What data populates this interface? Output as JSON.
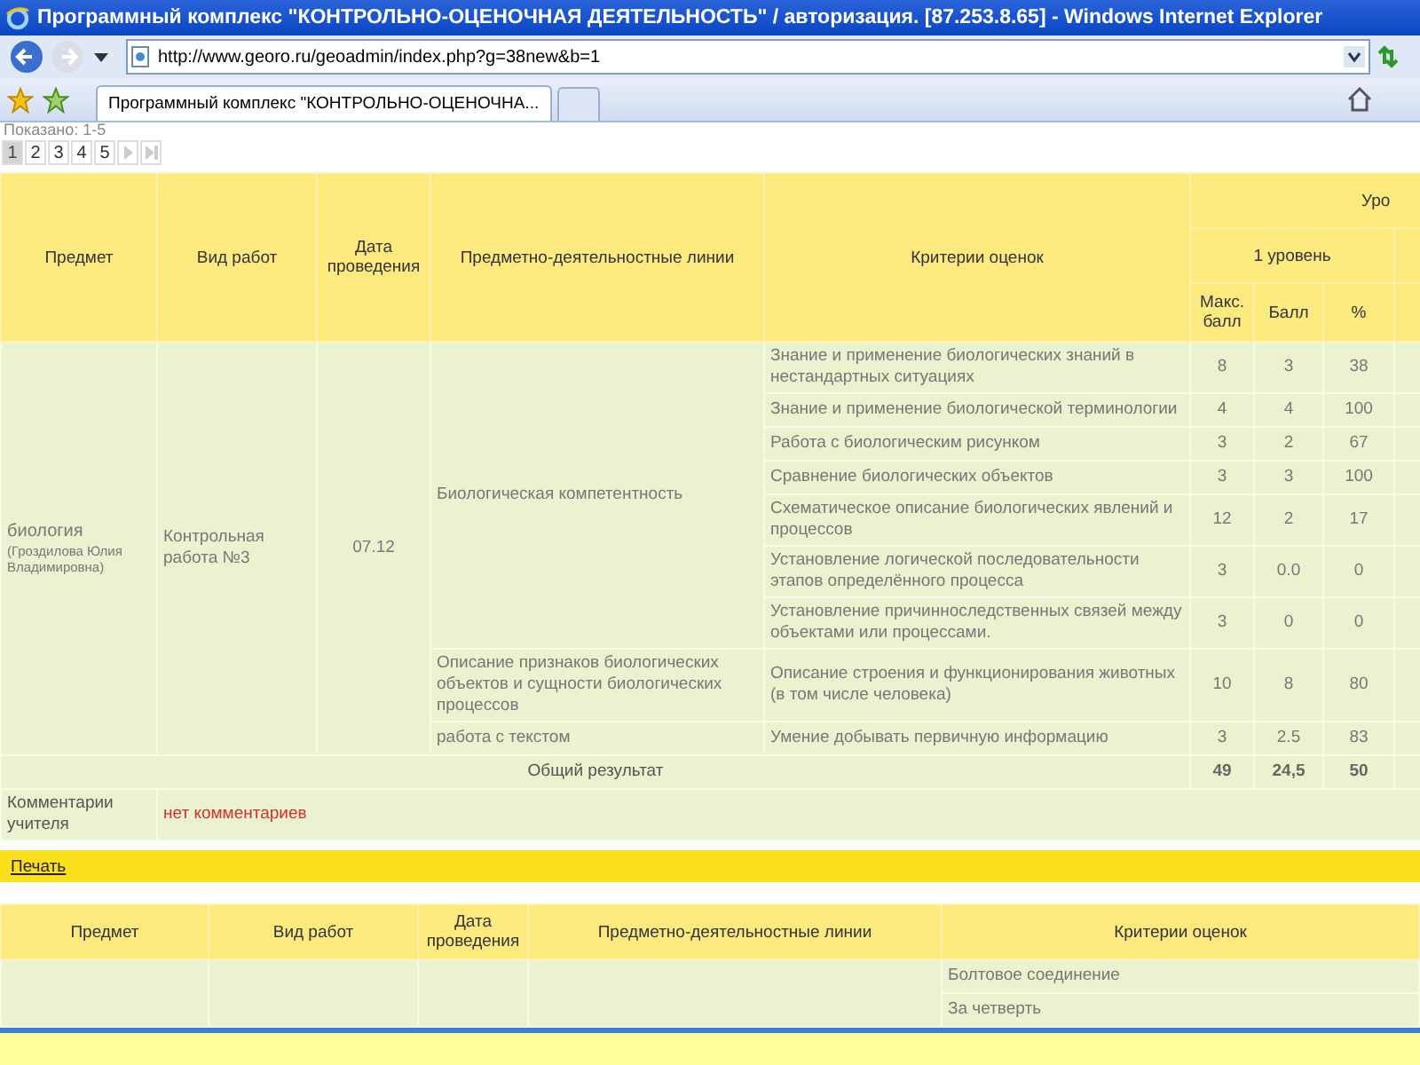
{
  "browser": {
    "title": "Программный комплекс \"КОНТРОЛЬНО-ОЦЕНОЧНАЯ ДЕЯТЕЛЬНОСТЬ\" / авторизация. [87.253.8.65] - Windows Internet Explorer",
    "url": "http://www.georo.ru/geoadmin/index.php?g=38new&b=1",
    "tab_title": "Программный комплекс \"КОНТРОЛЬНО-ОЦЕНОЧНА..."
  },
  "pager": {
    "label": "Показано: 1-5",
    "pages": [
      {
        "label": "1",
        "selected": true
      },
      {
        "label": "2",
        "selected": false
      },
      {
        "label": "3",
        "selected": false
      },
      {
        "label": "4",
        "selected": false
      },
      {
        "label": "5",
        "selected": false
      }
    ]
  },
  "results": {
    "headers": {
      "subject": "Предмет",
      "work_type": "Вид работ",
      "date": "Дата проведения",
      "lines": "Предметно-деятельностные линии",
      "criteria": "Критерии оценок",
      "level_group": "Уро",
      "level": "1 уровень",
      "max": "Макс. балл",
      "score": "Балл",
      "percent": "%"
    },
    "subject": "биология",
    "teacher": "(Гроздилова Юлия Владимировна)",
    "work_type": "Контрольная работа №3",
    "date": "07.12",
    "lines": [
      {
        "name": "Биологическая компетентность",
        "criteria": [
          {
            "text": "Знание и применение биологических знаний в нестандартных ситуациях",
            "max": "8",
            "score": "3",
            "percent": "38"
          },
          {
            "text": "Знание и применение биологической терминологии",
            "max": "4",
            "score": "4",
            "percent": "100"
          },
          {
            "text": "Работа с биологическим рисунком",
            "max": "3",
            "score": "2",
            "percent": "67"
          },
          {
            "text": "Сравнение биологических объектов",
            "max": "3",
            "score": "3",
            "percent": "100"
          },
          {
            "text": "Схематическое описание биологических явлений и процессов",
            "max": "12",
            "score": "2",
            "percent": "17"
          },
          {
            "text": "Установление логической последовательности этапов определённого процесса",
            "max": "3",
            "score": "0.0",
            "percent": "0"
          },
          {
            "text": "Установление причинноследственных связей между объектами или процессами.",
            "max": "3",
            "score": "0",
            "percent": "0"
          }
        ]
      },
      {
        "name": "Описание признаков биологических объектов и сущности биологических процессов",
        "criteria": [
          {
            "text": "Описание строения и функционирования животных (в том числе человека)",
            "max": "10",
            "score": "8",
            "percent": "80"
          }
        ]
      },
      {
        "name": "работа с текстом",
        "criteria": [
          {
            "text": "Умение добывать первичную информацию",
            "max": "3",
            "score": "2.5",
            "percent": "83"
          }
        ]
      }
    ],
    "total": {
      "label": "Общий результат",
      "max": "49",
      "score": "24,5",
      "percent": "50"
    },
    "comment": {
      "label": "Комментарии учителя",
      "value": "нет комментариев"
    }
  },
  "print_link": "Печать",
  "second_table": {
    "headers": {
      "subject": "Предмет",
      "work_type": "Вид работ",
      "date": "Дата проведения",
      "lines": "Предметно-деятельностные линии",
      "criteria": "Критерии оценок"
    },
    "criteria": [
      "Болтовое соединение",
      "За четверть"
    ]
  }
}
